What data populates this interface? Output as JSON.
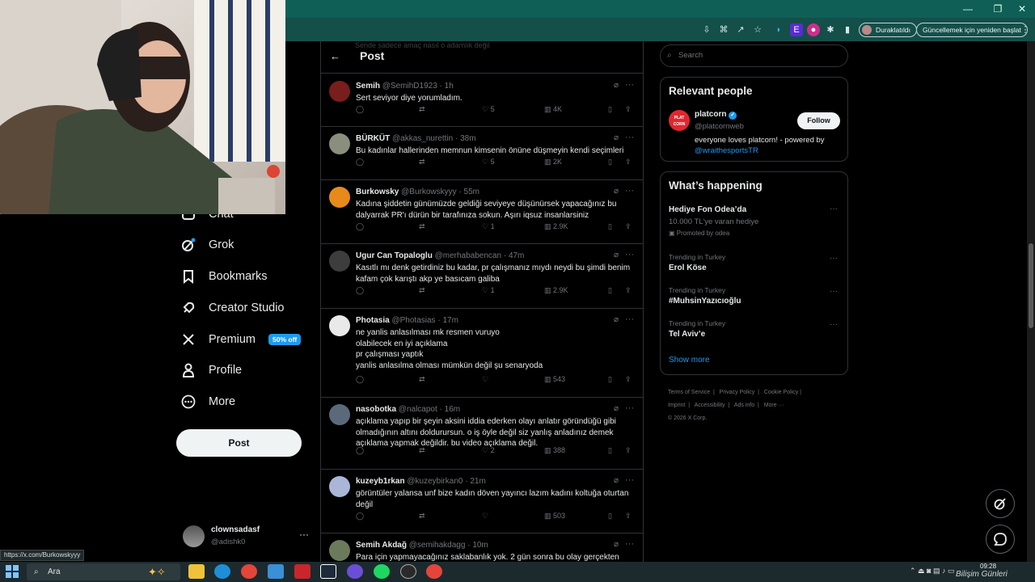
{
  "browser": {
    "profile_pill": "Duraklatıldı",
    "update_pill": "Güncellemek için yeniden başlat",
    "status_url": "https://x.com/Burkowskyyy"
  },
  "nav": {
    "items": [
      {
        "label": "Chat",
        "icon": "chat-icon"
      },
      {
        "label": "Grok",
        "icon": "grok-icon"
      },
      {
        "label": "Bookmarks",
        "icon": "bookmark-icon"
      },
      {
        "label": "Creator Studio",
        "icon": "rocket-icon"
      },
      {
        "label": "Premium",
        "icon": "x-logo-icon",
        "badge": "50% off"
      },
      {
        "label": "Profile",
        "icon": "person-icon"
      },
      {
        "label": "More",
        "icon": "more-circle-icon"
      }
    ],
    "post_button": "Post",
    "account": {
      "name": "clownsadasf",
      "handle": "@adishk0"
    }
  },
  "header": {
    "title": "Post",
    "faded_text": "Sende sadece amaç nasıl o adamlık değil"
  },
  "tweets": [
    {
      "name": "Semih",
      "handle": "@SemihD1923",
      "time": "1h",
      "text": "Sert seviyor diye yorumladım.",
      "likes": "5",
      "views": "4K",
      "av": "#7a1d1d"
    },
    {
      "name": "BÜRKÜT",
      "handle": "@akkas_nurettin",
      "time": "38m",
      "text": "Bu kadınlar hallerinden memnun kimsenin önüne düşmeyin kendi seçimleri",
      "likes": "5",
      "views": "2K",
      "av": "#8a8e7e"
    },
    {
      "name": "Burkowsky",
      "handle": "@Burkowskyyy",
      "time": "55m",
      "text": "Kadına şiddetin günümüzde geldiği seviyeye düşünürsek yapacağınız bu dalyarrak PR'ı dürün bir tarafınıza sokun. Aşırı iqsuz insanlarsiniz",
      "likes": "1",
      "views": "2.9K",
      "av": "#e88a1a"
    },
    {
      "name": "Ugur Can Topaloglu",
      "handle": "@merhababencan",
      "time": "47m",
      "text": "Kasıtlı mı denk getirdiniz bu kadar, pr çalışmanız mıydı neydi bu şimdi benim kafam çok karıştı akp ye basıcam galiba",
      "likes": "1",
      "views": "2.9K",
      "av": "#3d3d3d"
    },
    {
      "name": "Photasia",
      "handle": "@Photasias",
      "time": "17m",
      "text": "ne yanlis anlasılması mk resmen vuruyo\nolabilecek en iyi açıklama\npr çalışması yaptık\nyanlis anlasılma olması mümkün değil şu senaryoda",
      "likes": "",
      "views": "543",
      "av": "#e9e9e9"
    },
    {
      "name": "nasobotka",
      "handle": "@nalcapot",
      "time": "16m",
      "text": "açıklama yapıp bir şeyin aksini iddia ederken olayı anlatır göründüğü gibi olmadığının altını doldurursun. o iş öyle değil siz yanlış anladınız demek açıklama yapmak değildir. bu video açıklama değil.",
      "likes": "2",
      "views": "388",
      "av": "#5a6a7a"
    },
    {
      "name": "kuzeyb1rkan",
      "handle": "@kuzeybirkan0",
      "time": "21m",
      "text": "görüntüler yalansa unf bize kadın döven yayıncı lazım kadını koltuğa oturtan değil",
      "likes": "",
      "views": "503",
      "av": "#a9b6d8"
    },
    {
      "name": "Semih Akdağ",
      "handle": "@semihakdagg",
      "time": "10m",
      "text": "Para için yapmayacağınız saklabanlık yok. 2 gün sonra bu olay gerçekten",
      "likes": "",
      "views": "",
      "av": "#6b7a5a"
    }
  ],
  "right": {
    "search_placeholder": "Search",
    "relevant_title": "Relevant people",
    "person": {
      "name": "platcorn",
      "handle": "@platcornweb",
      "bio": "everyone loves platcorn! - powered by",
      "bio_link": "@wraithesportsTR",
      "follow": "Follow",
      "logo_text": "PLAT CORN"
    },
    "happening_title": "What’s happening",
    "promo": {
      "title": "Hediye Fon Odea’da",
      "sub": "10.000 TL’ye varan hediye",
      "promoted": "Promoted by odea"
    },
    "trends": [
      {
        "context": "Trending in Turkey",
        "name": "Erol Köse"
      },
      {
        "context": "Trending in Turkey",
        "name": "#MuhsinYazıcıoğlu"
      },
      {
        "context": "Trending in Turkey",
        "name": "Tel Aviv’e"
      }
    ],
    "show_more": "Show more",
    "footer1": [
      "Terms of Service",
      "Privacy Policy",
      "Cookie Policy"
    ],
    "footer2": [
      "Imprint",
      "Accessibility",
      "Ads info",
      "More ···"
    ],
    "copyright": "© 2026 X Corp."
  },
  "taskbar": {
    "search": "Ara",
    "time": "09:28",
    "watermark": "Bilişim Günleri"
  },
  "colors": {
    "accent": "#1d9bf0",
    "titlebar": "#0f5f57",
    "border": "#2f3336"
  }
}
